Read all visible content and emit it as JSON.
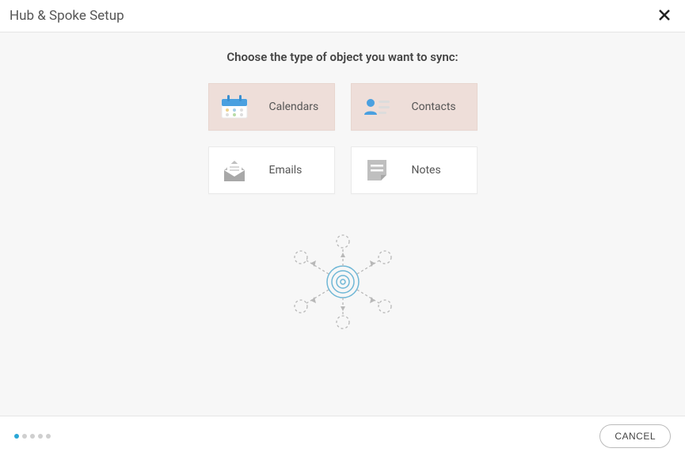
{
  "header": {
    "title": "Hub & Spoke Setup"
  },
  "main": {
    "prompt": "Choose the type of object you want to sync:",
    "options": [
      {
        "label": "Calendars",
        "selected": true,
        "icon": "calendar-icon"
      },
      {
        "label": "Contacts",
        "selected": true,
        "icon": "contact-icon"
      },
      {
        "label": "Emails",
        "selected": false,
        "icon": "email-icon"
      },
      {
        "label": "Notes",
        "selected": false,
        "icon": "note-icon"
      }
    ]
  },
  "footer": {
    "total_steps": 5,
    "current_step": 1,
    "cancel_label": "CANCEL"
  }
}
